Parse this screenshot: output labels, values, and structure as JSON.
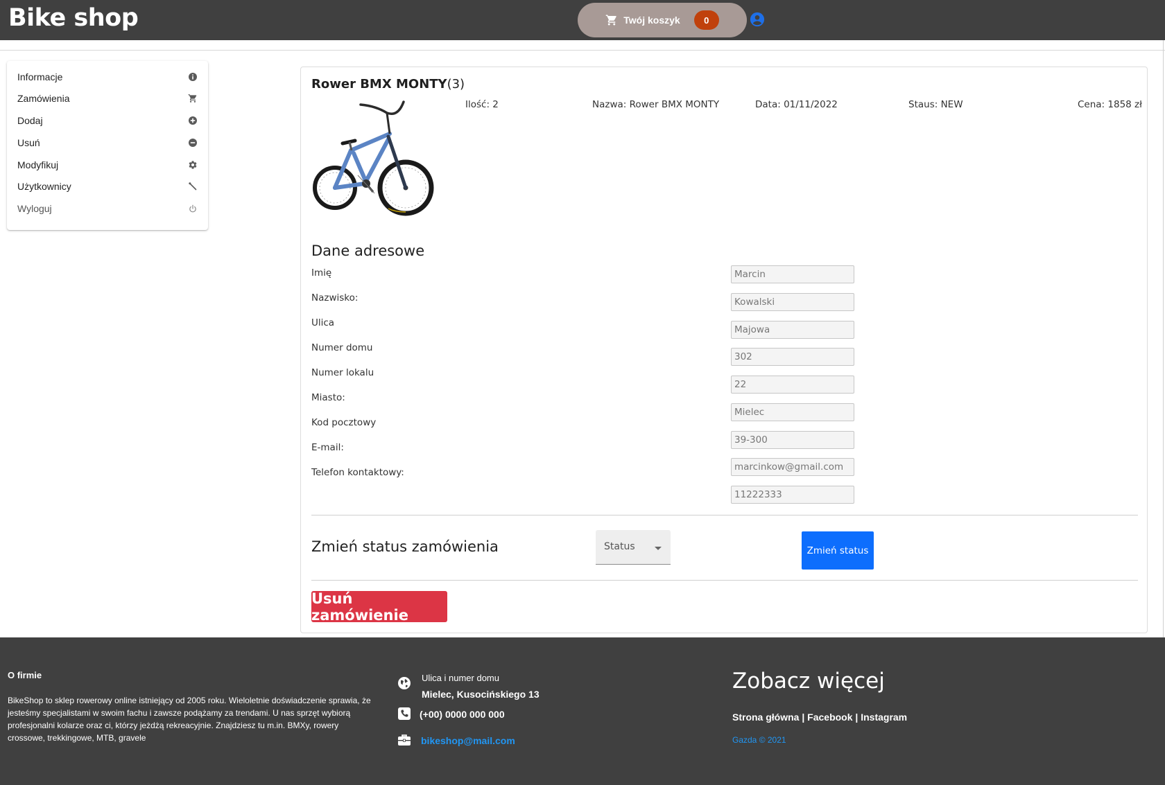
{
  "header": {
    "brand": "Bike shop",
    "cart_label": "Twój koszyk",
    "cart_count": "0"
  },
  "sidebar": {
    "items": [
      {
        "label": "Informacje",
        "icon": "info-icon"
      },
      {
        "label": "Zamówienia",
        "icon": "cart-icon"
      },
      {
        "label": "Dodaj",
        "icon": "plus-circle-icon"
      },
      {
        "label": "Usuń",
        "icon": "minus-circle-icon"
      },
      {
        "label": "Modyfikuj",
        "icon": "gear-icon"
      },
      {
        "label": "Użytkownicy",
        "icon": "wrench-icon"
      },
      {
        "label": "Wyloguj",
        "icon": "power-icon"
      }
    ]
  },
  "order": {
    "product_name": "Rower BMX MONTY",
    "product_count": "(3)",
    "quantity": "Ilość: 2",
    "name": "Nazwa: Rower BMX MONTY",
    "date": "Data: 01/11/2022",
    "status": "Staus: NEW",
    "price": "Cena: 1858 zł"
  },
  "address": {
    "heading": "Dane adresowe",
    "labels": [
      "Imię",
      "Nazwisko:",
      "Ulica",
      "Numer domu",
      "Numer lokalu",
      "Miasto:",
      "Kod pocztowy",
      "E-mail:",
      "Telefon kontaktowy:"
    ],
    "values": [
      "Marcin",
      "Kowalski",
      "Majowa",
      "302",
      "22",
      "Mielec",
      "39-300",
      "marcinkow@gmail.com",
      "11222333"
    ]
  },
  "status_change": {
    "heading": "Zmień status zamówienia",
    "select_value": "Status",
    "button": "Zmień status"
  },
  "delete_button": "Usuń zamówienie",
  "footer": {
    "about_heading": "O firmie",
    "about_text": "BikeShop to sklep rowerowy online istniejący od 2005 roku. Wieloletnie doświadczenie sprawia, że jesteśmy specjalistami w swoim fachu i zawsze podążamy za trendami. U nas sprzęt wybiorą profesjonalni kolarze oraz ci, którzy jeżdżą rekreacyjnie. Znajdziesz tu m.in. BMXy, rowery crossowe, trekkingowe, MTB, gravele",
    "street_label": "Ulica i numer domu",
    "street_value": "Mielec, Kusocińskiego 13",
    "phone": "(+00) 0000 000 000",
    "email": "bikeshop@mail.com",
    "more_heading": "Zobacz więcej",
    "links": [
      "Strona główna",
      "Facebook",
      "Instagram"
    ],
    "separator": " | ",
    "copyright": "Gazda © 2021"
  },
  "colors": {
    "header_bg": "#404040",
    "cart_pill": "#a89a96",
    "cart_badge": "#c0410c",
    "primary": "#0d6efd",
    "danger": "#dc3545",
    "link": "#2196f3"
  }
}
